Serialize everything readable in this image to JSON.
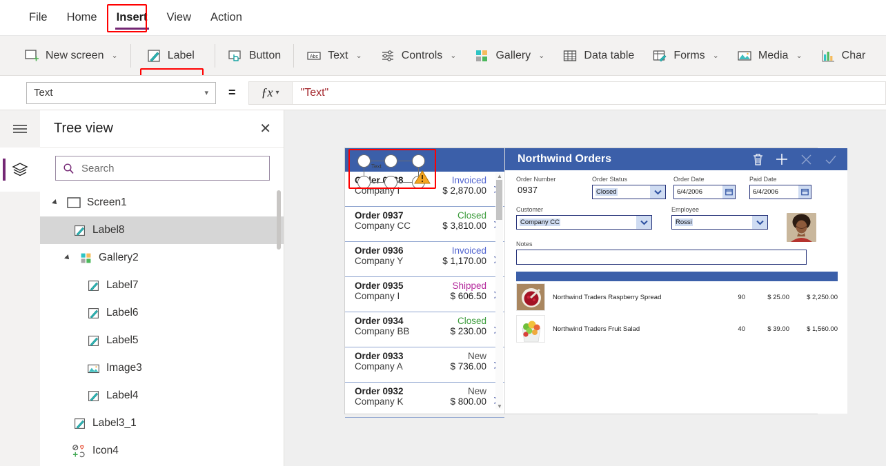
{
  "menu": {
    "items": [
      {
        "label": "File",
        "active": false
      },
      {
        "label": "Home",
        "active": false
      },
      {
        "label": "Insert",
        "active": true
      },
      {
        "label": "View",
        "active": false
      },
      {
        "label": "Action",
        "active": false
      }
    ]
  },
  "ribbon": {
    "items": [
      {
        "label": "New screen",
        "icon": "new-screen-icon",
        "chevron": "⌄",
        "highlight": false
      },
      {
        "label": "Label",
        "icon": "label-icon",
        "chevron": "",
        "highlight": true
      },
      {
        "label": "Button",
        "icon": "button-icon",
        "chevron": "",
        "highlight": false
      },
      {
        "label": "Text",
        "icon": "text-abc-icon",
        "chevron": "⌄",
        "highlight": false
      },
      {
        "label": "Controls",
        "icon": "controls-sliders-icon",
        "chevron": "⌄",
        "highlight": false
      },
      {
        "label": "Gallery",
        "icon": "gallery-icon",
        "chevron": "⌄",
        "highlight": false
      },
      {
        "label": "Data table",
        "icon": "data-table-icon",
        "chevron": "",
        "highlight": false
      },
      {
        "label": "Forms",
        "icon": "forms-icon",
        "chevron": "⌄",
        "highlight": false
      },
      {
        "label": "Media",
        "icon": "media-image-icon",
        "chevron": "⌄",
        "highlight": false
      },
      {
        "label": "Char",
        "icon": "chart-icon",
        "chevron": "",
        "highlight": false
      }
    ]
  },
  "formula_bar": {
    "property": "Text",
    "equals": "=",
    "fx_label": "ƒx",
    "expression": "\"Text\""
  },
  "left_rail": {
    "hamburger": "hamburger-icon",
    "tree_view_button": "layers-icon"
  },
  "tree_view": {
    "title": "Tree view",
    "close": "✕",
    "search_placeholder": "Search",
    "search_value": "",
    "nodes": [
      {
        "label": "Screen1",
        "indent": 0,
        "icon": "screen-icon",
        "caret": true,
        "selected": false
      },
      {
        "label": "Label8",
        "indent": 1,
        "icon": "label-icon",
        "caret": false,
        "selected": true
      },
      {
        "label": "Gallery2",
        "indent": 1,
        "icon": "gallery-icon",
        "caret": true,
        "selected": false
      },
      {
        "label": "Label7",
        "indent": 2,
        "icon": "label-icon",
        "caret": false,
        "selected": false
      },
      {
        "label": "Label6",
        "indent": 2,
        "icon": "label-icon",
        "caret": false,
        "selected": false
      },
      {
        "label": "Label5",
        "indent": 2,
        "icon": "label-icon",
        "caret": false,
        "selected": false
      },
      {
        "label": "Image3",
        "indent": 2,
        "icon": "image-icon",
        "caret": false,
        "selected": false
      },
      {
        "label": "Label4",
        "indent": 2,
        "icon": "label-icon",
        "caret": false,
        "selected": false
      },
      {
        "label": "Label3_1",
        "indent": 1,
        "icon": "label-icon",
        "caret": false,
        "selected": false
      },
      {
        "label": "Icon4",
        "indent": 1,
        "icon": "icons-icon",
        "caret": false,
        "selected": false
      }
    ]
  },
  "canvas": {
    "selection": {
      "tag": "Text",
      "warning_icon": "warning-triangle-icon"
    },
    "gallery": {
      "items": [
        {
          "order": "Order 0938",
          "company": "Company I",
          "status": "Invoiced",
          "status_color": "#5063cf",
          "amount": "$ 2,870.00"
        },
        {
          "order": "Order 0937",
          "company": "Company CC",
          "status": "Closed",
          "status_color": "#3c9c3c",
          "amount": "$ 3,810.00"
        },
        {
          "order": "Order 0936",
          "company": "Company Y",
          "status": "Invoiced",
          "status_color": "#5063cf",
          "amount": "$ 1,170.00"
        },
        {
          "order": "Order 0935",
          "company": "Company I",
          "status": "Shipped",
          "status_color": "#b4299c",
          "amount": "$ 606.50"
        },
        {
          "order": "Order 0934",
          "company": "Company BB",
          "status": "Closed",
          "status_color": "#3c9c3c",
          "amount": "$ 230.00"
        },
        {
          "order": "Order 0933",
          "company": "Company A",
          "status": "New",
          "status_color": "#4a4a4a",
          "amount": "$ 736.00"
        },
        {
          "order": "Order 0932",
          "company": "Company K",
          "status": "New",
          "status_color": "#4a4a4a",
          "amount": "$ 800.00"
        }
      ]
    },
    "detail": {
      "title": "Northwind Orders",
      "header_icons": [
        "trash-icon",
        "plus-icon",
        "cancel-x-icon",
        "check-icon"
      ],
      "fields": {
        "order_number_label": "Order Number",
        "order_number_value": "0937",
        "order_status_label": "Order Status",
        "order_status_value": "Closed",
        "order_date_label": "Order Date",
        "order_date_value": "6/4/2006",
        "paid_date_label": "Paid Date",
        "paid_date_value": "6/4/2006",
        "customer_label": "Customer",
        "customer_value": "Company CC",
        "employee_label": "Employee",
        "employee_value": "Rossi",
        "notes_label": "Notes",
        "notes_value": ""
      },
      "products": [
        {
          "name": "Northwind Traders Raspberry Spread",
          "qty": "90",
          "price": "$ 25.00",
          "total": "$ 2,250.00",
          "image": "raspberry-spread-photo"
        },
        {
          "name": "Northwind Traders Fruit Salad",
          "qty": "40",
          "price": "$ 39.00",
          "total": "$ 1,560.00",
          "image": "fruit-salad-photo"
        }
      ]
    }
  },
  "colors": {
    "accent_purple": "#742774",
    "app_blue": "#3b5fa9",
    "highlight_red": "#ff0000",
    "formula_red": "#a4262c"
  }
}
